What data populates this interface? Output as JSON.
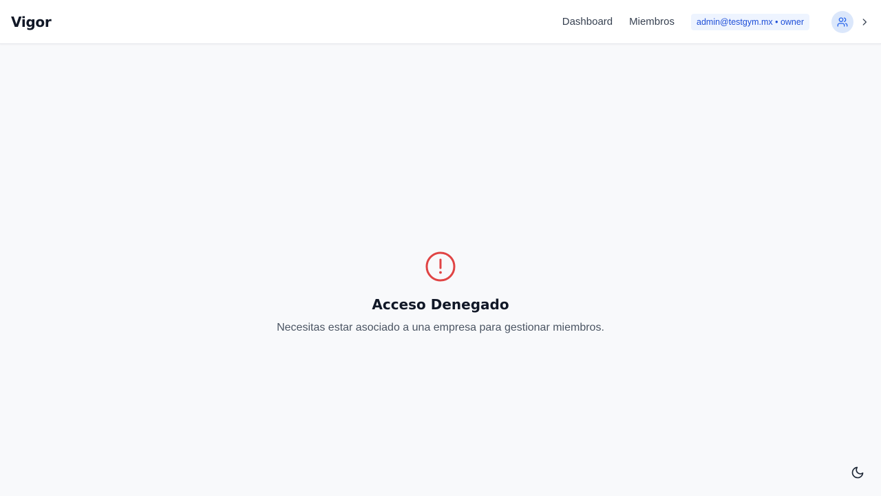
{
  "header": {
    "brand": "Vigor",
    "nav": [
      {
        "label": "Dashboard"
      },
      {
        "label": "Miembros"
      }
    ],
    "user_badge": "admin@testgym.mx • owner",
    "avatar_icon": "users-icon",
    "chevron_icon": "chevron-right-icon"
  },
  "main": {
    "alert_icon": "alert-circle-icon",
    "title": "Acceso Denegado",
    "message": "Necesitas estar asociado a una empresa para gestionar miembros."
  },
  "theme_toggle_icon": "moon-icon",
  "colors": {
    "alert": "#e04444",
    "accent": "#1d4ed8",
    "badge_bg": "#eef4ff"
  }
}
